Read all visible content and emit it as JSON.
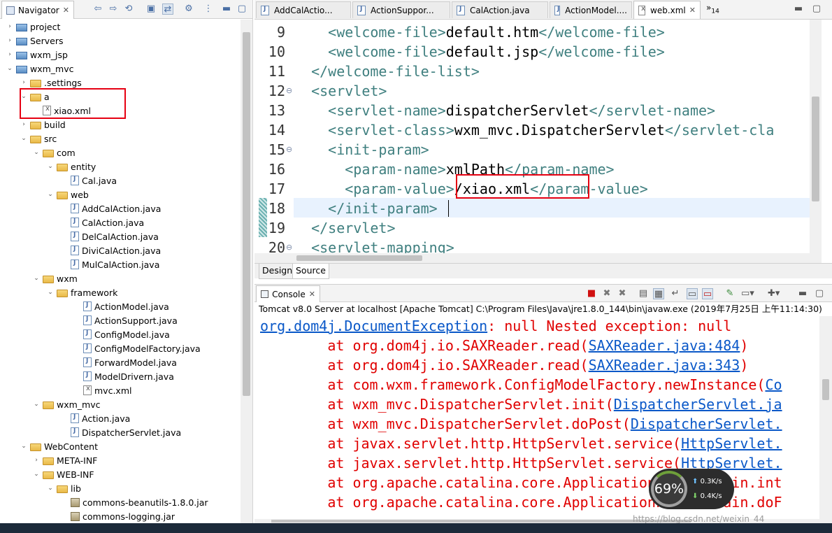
{
  "navigator": {
    "title": "Navigator",
    "tree": [
      {
        "label": "project",
        "icon": "project-icon",
        "twisty": ">",
        "indent": 0
      },
      {
        "label": "Servers",
        "icon": "project-icon",
        "twisty": ">",
        "indent": 0
      },
      {
        "label": "wxm_jsp",
        "icon": "project-icon",
        "twisty": ">",
        "indent": 0
      },
      {
        "label": "wxm_mvc",
        "icon": "project-icon",
        "twisty": "v",
        "indent": 0
      },
      {
        "label": ".settings",
        "icon": "folder-icon",
        "twisty": ">",
        "indent": 1
      },
      {
        "label": "a",
        "icon": "folder-icon",
        "twisty": "v",
        "indent": 1
      },
      {
        "label": "xiao.xml",
        "icon": "xml-file-icon",
        "twisty": "",
        "indent": 2
      },
      {
        "label": "build",
        "icon": "folder-icon",
        "twisty": ">",
        "indent": 1
      },
      {
        "label": "src",
        "icon": "folder-icon",
        "twisty": "v",
        "indent": 1
      },
      {
        "label": "com",
        "icon": "folder-icon",
        "twisty": "v",
        "indent": 2
      },
      {
        "label": "entity",
        "icon": "folder-icon",
        "twisty": "v",
        "indent": 3
      },
      {
        "label": "Cal.java",
        "icon": "java-file-icon",
        "twisty": "",
        "indent": 4
      },
      {
        "label": "web",
        "icon": "folder-icon",
        "twisty": "v",
        "indent": 3
      },
      {
        "label": "AddCalAction.java",
        "icon": "java-file-icon",
        "twisty": "",
        "indent": 4
      },
      {
        "label": "CalAction.java",
        "icon": "java-file-icon",
        "twisty": "",
        "indent": 4
      },
      {
        "label": "DelCalAction.java",
        "icon": "java-file-icon",
        "twisty": "",
        "indent": 4
      },
      {
        "label": "DiviCalAction.java",
        "icon": "java-file-icon",
        "twisty": "",
        "indent": 4
      },
      {
        "label": "MulCalAction.java",
        "icon": "java-file-icon",
        "twisty": "",
        "indent": 4
      },
      {
        "label": "wxm",
        "icon": "folder-icon",
        "twisty": "v",
        "indent": 2
      },
      {
        "label": "framework",
        "icon": "folder-icon",
        "twisty": "v",
        "indent": 3
      },
      {
        "label": "ActionModel.java",
        "icon": "java-file-icon",
        "twisty": "",
        "indent": 5
      },
      {
        "label": "ActionSupport.java",
        "icon": "java-file-icon",
        "twisty": "",
        "indent": 5
      },
      {
        "label": "ConfigModel.java",
        "icon": "java-file-icon",
        "twisty": "",
        "indent": 5
      },
      {
        "label": "ConfigModelFactory.java",
        "icon": "java-file-icon",
        "twisty": "",
        "indent": 5
      },
      {
        "label": "ForwardModel.java",
        "icon": "java-file-icon",
        "twisty": "",
        "indent": 5
      },
      {
        "label": "ModelDrivern.java",
        "icon": "java-file-icon",
        "twisty": "",
        "indent": 5
      },
      {
        "label": "mvc.xml",
        "icon": "xml-file-icon",
        "twisty": "",
        "indent": 5
      },
      {
        "label": "wxm_mvc",
        "icon": "folder-icon",
        "twisty": "v",
        "indent": 2
      },
      {
        "label": "Action.java",
        "icon": "java-file-icon",
        "twisty": "",
        "indent": 4
      },
      {
        "label": "DispatcherServlet.java",
        "icon": "java-file-icon",
        "twisty": "",
        "indent": 4
      },
      {
        "label": "WebContent",
        "icon": "folder-icon",
        "twisty": "v",
        "indent": 1
      },
      {
        "label": "META-INF",
        "icon": "folder-icon",
        "twisty": ">",
        "indent": 2
      },
      {
        "label": "WEB-INF",
        "icon": "folder-icon",
        "twisty": "v",
        "indent": 2
      },
      {
        "label": "lib",
        "icon": "folder-icon",
        "twisty": "v",
        "indent": 3
      },
      {
        "label": "commons-beanutils-1.8.0.jar",
        "icon": "jar-icon",
        "twisty": "",
        "indent": 4
      },
      {
        "label": "commons-logging.jar",
        "icon": "jar-icon",
        "twisty": "",
        "indent": 4
      }
    ]
  },
  "editor": {
    "tabs": [
      {
        "label": "AddCalActio...",
        "active": false
      },
      {
        "label": "ActionSuppor...",
        "active": false
      },
      {
        "label": "CalAction.java",
        "active": false
      },
      {
        "label": "ActionModel....",
        "active": false
      },
      {
        "label": "web.xml",
        "active": true
      }
    ],
    "overflow_count": "14",
    "lines": [
      {
        "num": "9",
        "fold": "",
        "text": "    <welcome-file>default.htm</welcome-file>"
      },
      {
        "num": "10",
        "fold": "",
        "text": "    <welcome-file>default.jsp</welcome-file>"
      },
      {
        "num": "11",
        "fold": "",
        "text": "  </welcome-file-list>"
      },
      {
        "num": "12",
        "fold": "⊖",
        "text": "  <servlet>"
      },
      {
        "num": "13",
        "fold": "",
        "text": "    <servlet-name>dispatcherServlet</servlet-name>"
      },
      {
        "num": "14",
        "fold": "",
        "text": "    <servlet-class>wxm_mvc.DispatcherServlet</servlet-cla"
      },
      {
        "num": "15",
        "fold": "⊖",
        "text": "    <init-param>"
      },
      {
        "num": "16",
        "fold": "",
        "text": "      <param-name>xmlPath</param-name>"
      },
      {
        "num": "17",
        "fold": "",
        "text": "      <param-value>/xiao.xml</param-value>"
      },
      {
        "num": "18",
        "fold": "",
        "text": "    </init-param>"
      },
      {
        "num": "19",
        "fold": "",
        "text": "  </servlet>"
      },
      {
        "num": "20",
        "fold": "⊖",
        "text": "  <servlet-mapping>"
      }
    ],
    "design_tab": "Design",
    "source_tab": "Source"
  },
  "console": {
    "title": "Console",
    "description": "Tomcat v8.0 Server at localhost [Apache Tomcat] C:\\Program Files\\Java\\jre1.8.0_144\\bin\\javaw.exe (2019年7月25日 上午11:14:30)",
    "lines": [
      {
        "prefix": "",
        "method": "",
        "link": "org.dom4j.DocumentException",
        "suffix": ": null Nested exception: null"
      },
      {
        "prefix": "        at ",
        "method": "org.dom4j.io.SAXReader.read(",
        "link": "SAXReader.java:484",
        "suffix": ")"
      },
      {
        "prefix": "        at ",
        "method": "org.dom4j.io.SAXReader.read(",
        "link": "SAXReader.java:343",
        "suffix": ")"
      },
      {
        "prefix": "        at ",
        "method": "com.wxm.framework.ConfigModelFactory.newInstance(",
        "link": "Co",
        "suffix": ""
      },
      {
        "prefix": "        at ",
        "method": "wxm_mvc.DispatcherServlet.init(",
        "link": "DispatcherServlet.ja",
        "suffix": ""
      },
      {
        "prefix": "        at ",
        "method": "wxm_mvc.DispatcherServlet.doPost(",
        "link": "DispatcherServlet.",
        "suffix": ""
      },
      {
        "prefix": "        at ",
        "method": "javax.servlet.http.HttpServlet.service(",
        "link": "HttpServlet.",
        "suffix": ""
      },
      {
        "prefix": "        at ",
        "method": "javax.servlet.http.HttpServlet.service(",
        "link": "HttpServlet.",
        "suffix": ""
      },
      {
        "prefix": "        at ",
        "method": "org.apache.catalina.core.ApplicationFilterChain.int",
        "link": "",
        "suffix": ""
      },
      {
        "prefix": "        at ",
        "method": "org.apache.catalina.core.ApplicationFilterChain.doF",
        "link": "",
        "suffix": ""
      }
    ]
  },
  "network_widget": {
    "cpu_percent": "69%",
    "up_rate": "0.3K/s",
    "down_rate": "0.4K/s"
  },
  "watermark": "https://blog.csdn.net/weixin_44"
}
